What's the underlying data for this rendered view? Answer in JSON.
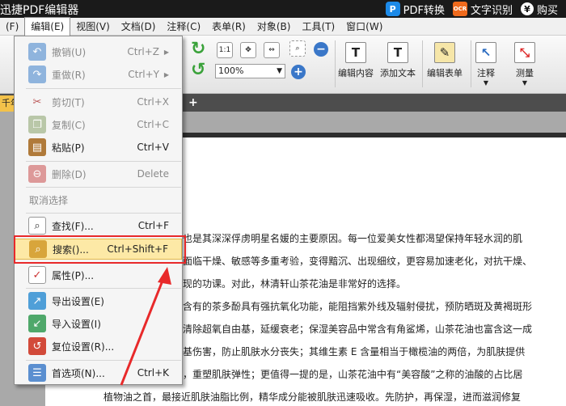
{
  "window": {
    "title": "迅捷PDF编辑器",
    "pdf_convert": "PDF转换",
    "ocr": "文字识别",
    "ocr_badge": "OCR",
    "buy": "购买",
    "pdf_badge": "P",
    "buy_badge": "¥"
  },
  "menubar": {
    "items": [
      "(F)",
      "编辑(E)",
      "视图(V)",
      "文档(D)",
      "注释(C)",
      "表单(R)",
      "对象(B)",
      "工具(T)",
      "窗口(W)"
    ]
  },
  "toolbar": {
    "zoom_value": "100%",
    "edit_content": "编辑内容",
    "add_text": "添加文本",
    "edit_form": "编辑表单",
    "annotate": "注释",
    "measure": "测量",
    "actual_size": "1:1"
  },
  "tabs": {
    "doc_tab": "千年"
  },
  "edit_menu": {
    "undo": {
      "label": "撤销(U)",
      "shortcut": "Ctrl+Z"
    },
    "redo": {
      "label": "重做(R)",
      "shortcut": "Ctrl+Y"
    },
    "cut": {
      "label": "剪切(T)",
      "shortcut": "Ctrl+X"
    },
    "copy": {
      "label": "复制(C)",
      "shortcut": "Ctrl+C"
    },
    "paste": {
      "label": "粘贴(P)",
      "shortcut": "Ctrl+V"
    },
    "delete": {
      "label": "删除(D)",
      "shortcut": "Delete"
    },
    "deselect": {
      "label": "取消选择"
    },
    "find": {
      "label": "查找(F)...",
      "shortcut": "Ctrl+F"
    },
    "search": {
      "label": "搜索()...",
      "shortcut": "Ctrl+Shift+F"
    },
    "properties": {
      "label": "属性(P)..."
    },
    "export_settings": {
      "label": "导出设置(E)"
    },
    "import_settings": {
      "label": "导入设置(I)"
    },
    "reset_settings": {
      "label": "复位设置(R)..."
    },
    "preferences": {
      "label": "首选项(N)...",
      "shortcut": "Ctrl+K"
    }
  },
  "document": {
    "lines": [
      "也是其深深俘虏明星名媛的主要原因。每一位爱美女性都渴望保持年轻水润的肌",
      "面临干燥、敏感等多重考验，变得黯沉、出现细纹，更容易加速老化，对抗干燥、",
      "现的功课。对此，林清轩山茶花油是非常好的选择。",
      "含有的茶多酚具有强抗氧化功能，能阻挡紫外线及辐射侵扰，预防晒斑及黄褐斑形",
      "清除超氧自由基，延缓衰老；保湿美容品中常含有角鲨烯，山茶花油也富含这一成",
      "基伤害，防止肌肤水分丧失；其维生素 E 含量相当于橄榄油的两倍，为肌肤提供",
      "，重塑肌肤弹性；更值得一提的是，山茶花油中有“美容酸”之称的油酸的占比居",
      "植物油之首，最接近肌肤油脂比例，精华成分能被肌肤迅速吸收。先防护，再保湿，进而滋润修复"
    ]
  },
  "colors": {
    "highlight": "#fde9a6",
    "annotation_red": "#e8292a",
    "titlebar": "#1a1a1a"
  }
}
